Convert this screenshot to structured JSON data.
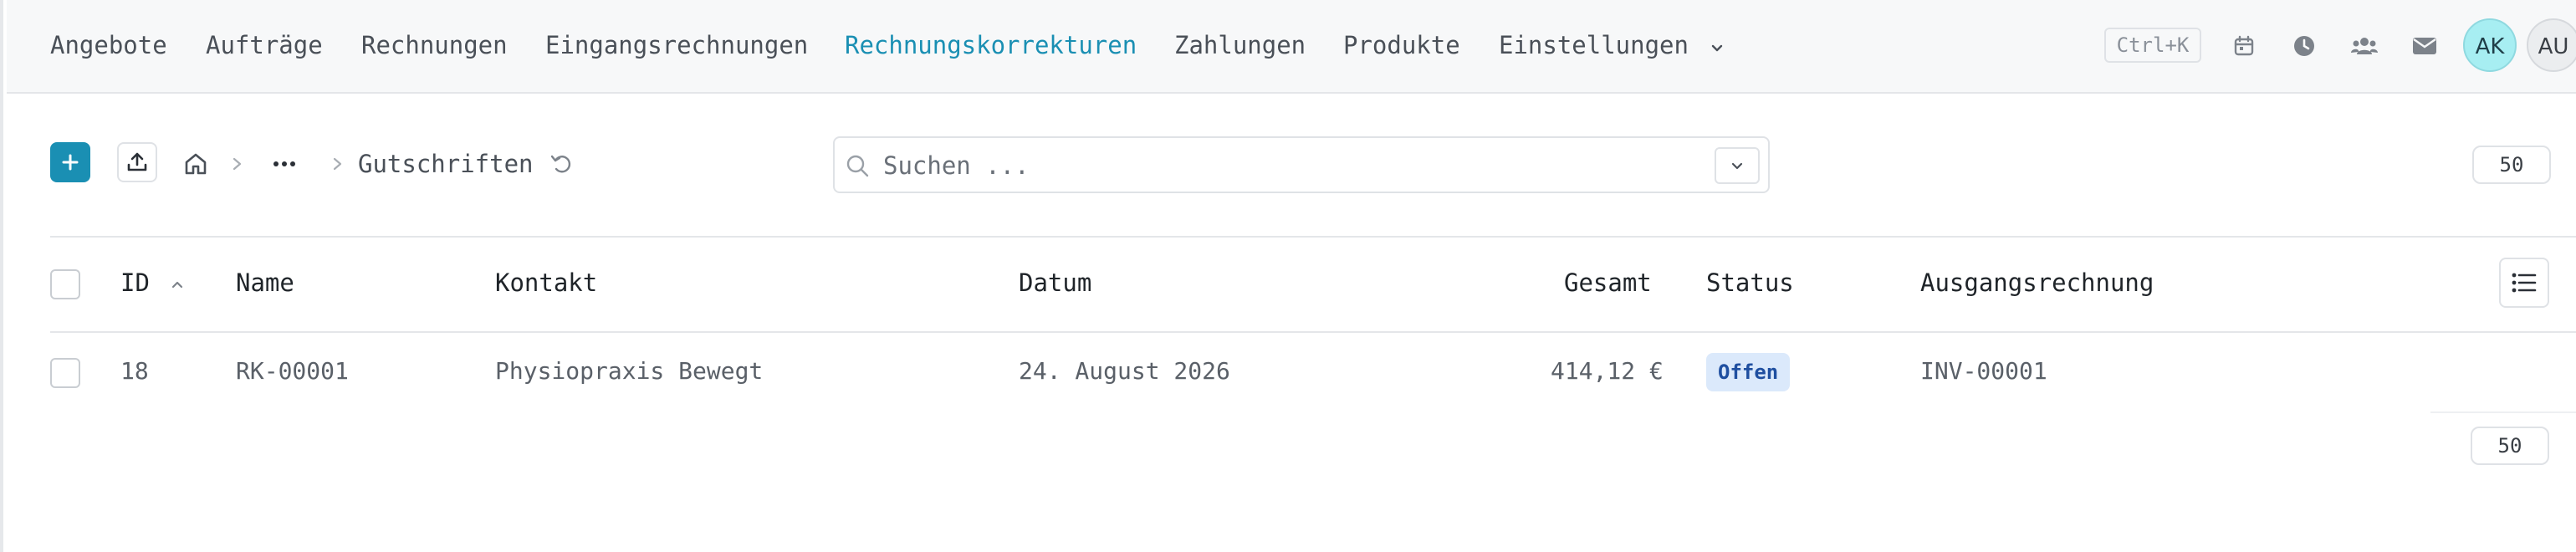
{
  "nav": {
    "items": [
      {
        "label": "Angebote"
      },
      {
        "label": "Aufträge"
      },
      {
        "label": "Rechnungen"
      },
      {
        "label": "Eingangsrechnungen"
      },
      {
        "label": "Rechnungskorrekturen",
        "active": true
      },
      {
        "label": "Zahlungen"
      },
      {
        "label": "Produkte"
      },
      {
        "label": "Einstellungen"
      }
    ],
    "shortcut": "Ctrl+K",
    "icons": [
      "calendar-icon",
      "clock-icon",
      "users-icon",
      "mail-icon"
    ],
    "avatars": [
      {
        "initials": "AK"
      },
      {
        "initials": "AU"
      }
    ]
  },
  "toolbar": {
    "breadcrumb_current": "Gutschriften",
    "search_placeholder": "Suchen ...",
    "page_size": "50"
  },
  "table": {
    "columns": [
      {
        "label": "ID"
      },
      {
        "label": "Name"
      },
      {
        "label": "Kontakt"
      },
      {
        "label": "Datum"
      },
      {
        "label": "Gesamt"
      },
      {
        "label": "Status"
      },
      {
        "label": "Ausgangsrechnung"
      }
    ],
    "rows": [
      {
        "id": "18",
        "name": "RK-00001",
        "kontakt": "Physiopraxis Bewegt",
        "datum": "24. August 2026",
        "gesamt": "414,12 €",
        "status": "Offen",
        "ausgangsrechnung": "INV-00001"
      }
    ],
    "footer_page_size": "50"
  },
  "colors": {
    "accent": "#1a8fb3",
    "status_badge_bg": "#dbe9fb",
    "status_badge_text": "#1f4fa0"
  }
}
